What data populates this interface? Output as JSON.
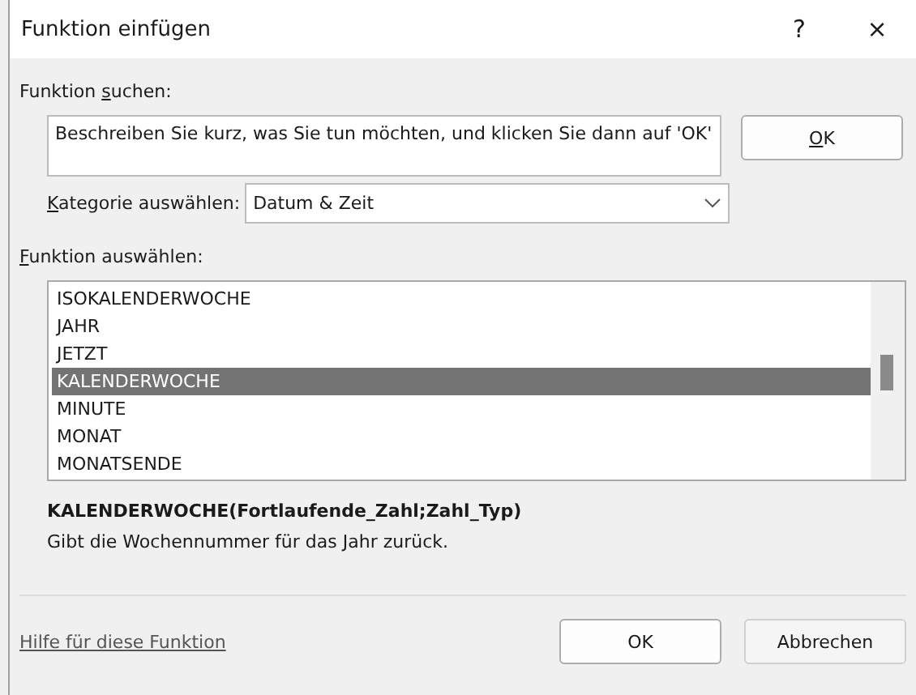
{
  "window": {
    "title": "Funktion einfügen",
    "help": "?",
    "close": "×"
  },
  "search": {
    "label_before": "Funktion ",
    "mnemonic": "s",
    "label_after": "uchen:",
    "value": "Beschreiben Sie kurz, was Sie tun möchten, und klicken Sie dann auf 'OK'",
    "button_mnemonic": "O",
    "button_rest": "K"
  },
  "category": {
    "mnemonic": "K",
    "label_after": "ategorie auswählen:",
    "value": "Datum & Zeit"
  },
  "function_list": {
    "mnemonic": "F",
    "label_after": "unktion auswählen:",
    "items": [
      {
        "label": "ISOKALENDERWOCHE",
        "selected": false
      },
      {
        "label": "JAHR",
        "selected": false
      },
      {
        "label": "JETZT",
        "selected": false
      },
      {
        "label": "KALENDERWOCHE",
        "selected": true
      },
      {
        "label": "MINUTE",
        "selected": false
      },
      {
        "label": "MONAT",
        "selected": false
      },
      {
        "label": "MONATSENDE",
        "selected": false
      }
    ]
  },
  "signature": "KALENDERWOCHE(Fortlaufende_Zahl;Zahl_Typ)",
  "description": "Gibt die Wochennummer für das Jahr zurück.",
  "help_link": "Hilfe für diese Funktion",
  "buttons": [
    "OK",
    "Abbrechen"
  ]
}
